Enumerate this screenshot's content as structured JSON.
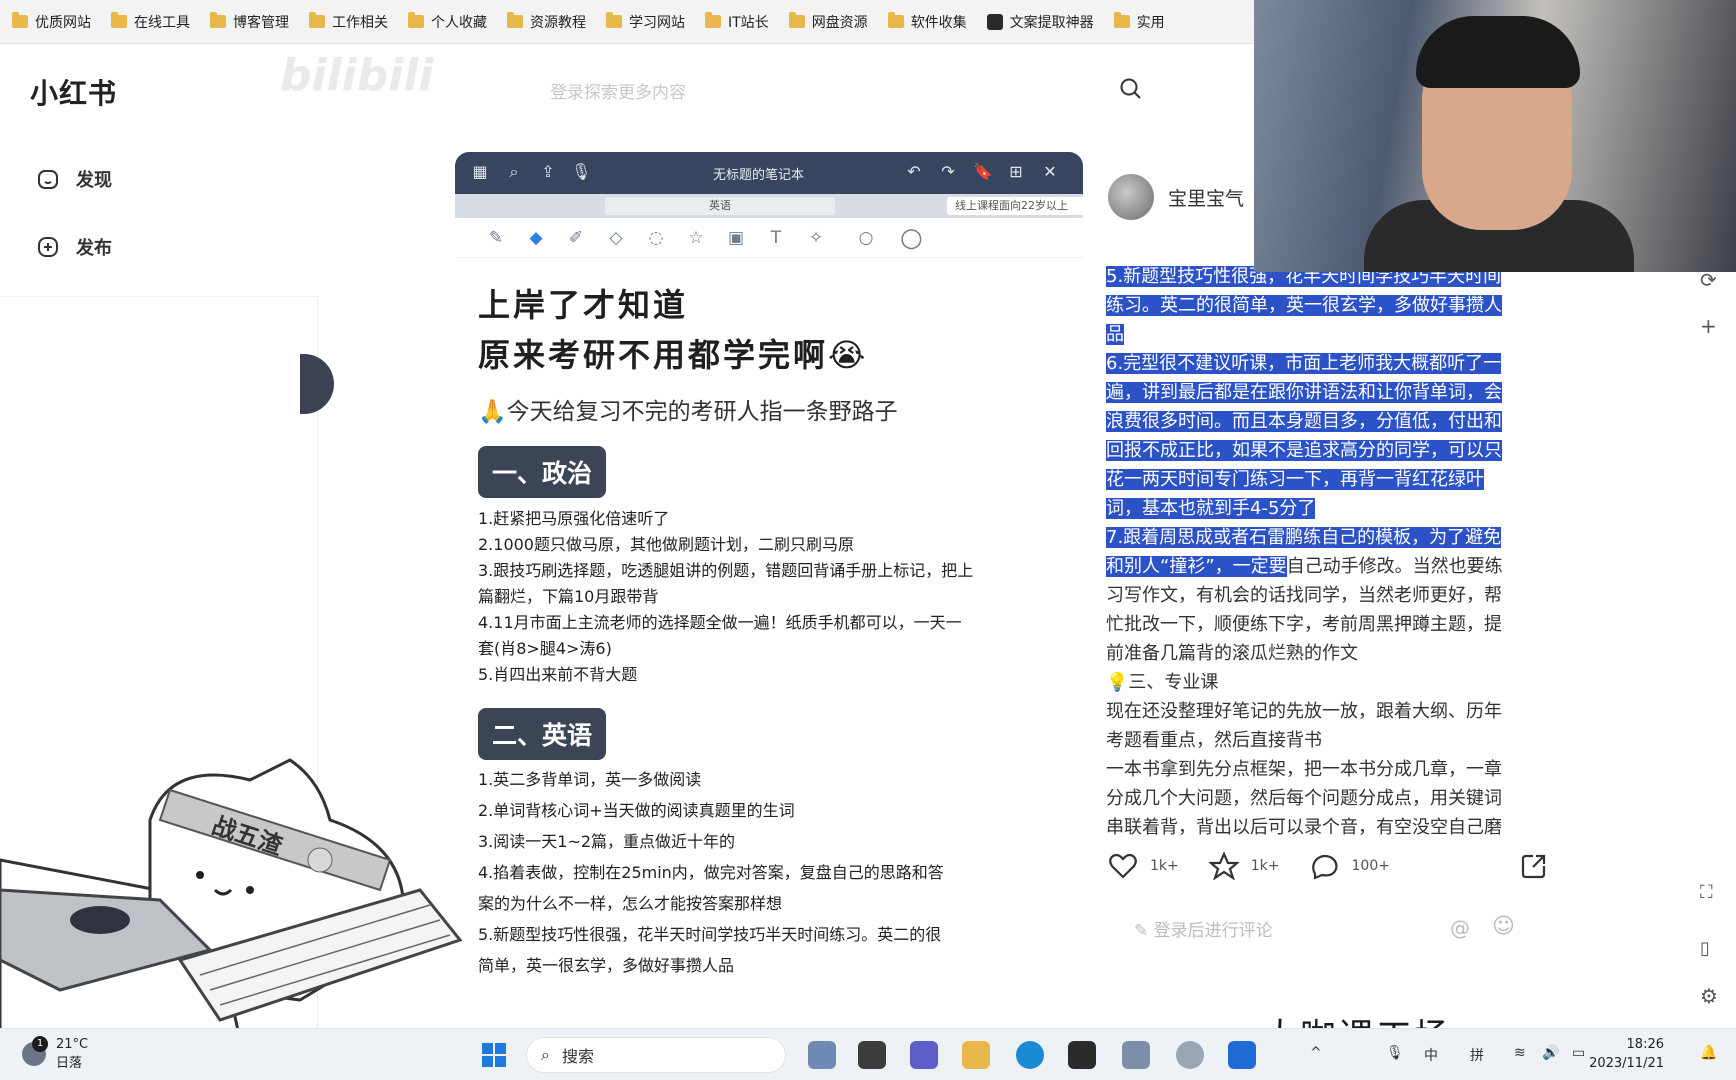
{
  "bookmarks": [
    "优质网站",
    "在线工具",
    "博客管理",
    "工作相关",
    "个人收藏",
    "资源教程",
    "学习网站",
    "IT站长",
    "网盘资源",
    "软件收集",
    "文案提取神器",
    "实用"
  ],
  "site": {
    "logo": "小红书",
    "search_placeholder": "登录探索更多内容"
  },
  "sidebar": {
    "items": [
      {
        "label": "发现",
        "icon": "home-icon"
      },
      {
        "label": "发布",
        "icon": "plus-square-icon"
      }
    ]
  },
  "notebook": {
    "title": "无标题的笔记本",
    "tabs": [
      "英语"
    ],
    "side_tab": "线上课程面向22岁以上"
  },
  "note": {
    "title_line1": "上岸了才知道",
    "title_line2": "原来考研不用都学完啊😭",
    "subtitle": "🙏今天给复习不完的考研人指一条野路子",
    "sections": [
      {
        "heading": "一、政治",
        "items": [
          "1.赶紧把马原强化倍速听了",
          "2.1000题只做马原，其他做刷题计划，二刷只刷马原",
          "3.跟技巧刷选择题，吃透腿姐讲的例题，错题回背诵手册上标记，把上",
          "篇翻烂，下篇10月跟带背",
          "4.11月市面上主流老师的选择题全做一遍！纸质手机都可以，一天一",
          "套(肖8>腿4>涛6)",
          "5.肖四出来前不背大题"
        ]
      },
      {
        "heading": "二、英语",
        "items": [
          "1.英二多背单词，英一多做阅读",
          "2.单词背核心词+当天做的阅读真题里的生词",
          "3.阅读一天1~2篇，重点做近十年的",
          "4.掐着表做，控制在25min内，做完对答案，复盘自己的思路和答",
          "案的为什么不一样，怎么才能按答案那样想",
          "5.新题型技巧性很强，花半天时间学技巧半天时间练习。英二的很",
          "简单，英一很玄学，多做好事攒人品"
        ]
      }
    ]
  },
  "sticker": {
    "headband_text": "战五渣"
  },
  "post": {
    "author": "宝里宝气",
    "lines_highlighted": [
      "5.新题型技巧性很强，花半天时间学技巧半天时间",
      "练习。英二的很简单，英一很玄学，多做好事攒人",
      "品",
      "6.完型很不建议听课，市面上老师我大概都听了一",
      "遍，讲到最后都是在跟你讲语法和让你背单词，会",
      "浪费很多时间。而且本身题目多，分值低，付出和",
      "回报不成正比，如果不是追求高分的同学，可以只",
      "花一两天时间专门练习一下，再背一背红花绿叶",
      "词，基本也就到手4-5分了",
      "7.跟着周思成或者石雷鹏练自己的模板，为了避免"
    ],
    "line_mixed_hl": "和别人“撞衫”，一定要",
    "line_mixed_rest": "自己动手修改。当然也要练",
    "lines_plain": [
      "习写作文，有机会的话找同学，当然老师更好，帮",
      "忙批改一下，顺便练下字，考前周黑押蹲主题，提",
      "前准备几篇背的滚瓜烂熟的作文",
      "💡三、专业课",
      "现在还没整理好笔记的先放一放，跟着大纲、历年",
      "考题看重点，然后直接背书",
      "一本书拿到先分点框架，把一本书分成几章，一章",
      "分成几个大问题，然后每个问题分成点，用关键词",
      "串联着背，背出以后可以录个音，有空没空自己磨"
    ],
    "likes": "1k+",
    "collects": "1k+",
    "comments": "100+",
    "comment_placeholder": "登录后进行评论"
  },
  "watermark": "大咖课工场",
  "taskbar": {
    "weather_temp": "21°C",
    "weather_desc": "日落",
    "weather_badge": "1",
    "search_label": "搜索",
    "ime_1": "中",
    "ime_2": "拼",
    "time": "18:26",
    "date": "2023/11/21"
  },
  "colors": {
    "highlight": "#2b52c7",
    "notebook_bar": "#37465e",
    "section_bg": "#3b4556"
  }
}
